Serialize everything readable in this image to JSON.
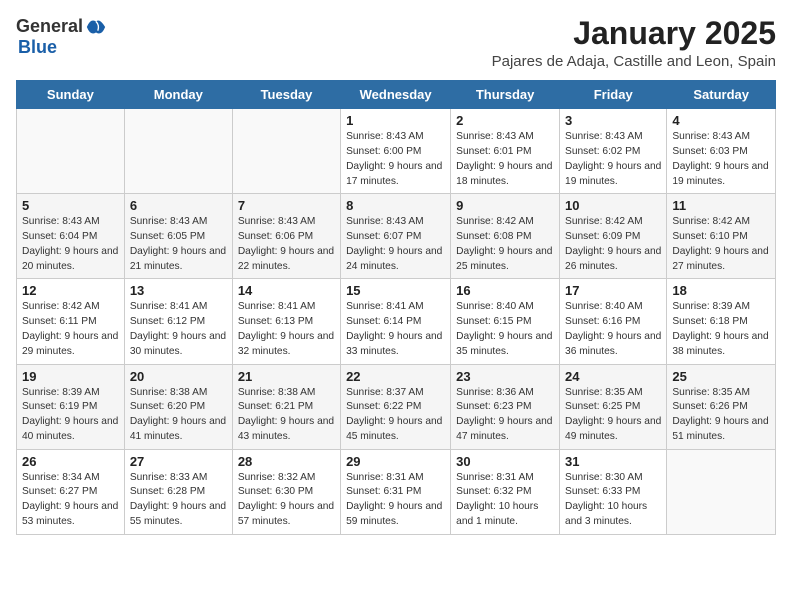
{
  "header": {
    "logo_general": "General",
    "logo_blue": "Blue",
    "month": "January 2025",
    "location": "Pajares de Adaja, Castille and Leon, Spain"
  },
  "weekdays": [
    "Sunday",
    "Monday",
    "Tuesday",
    "Wednesday",
    "Thursday",
    "Friday",
    "Saturday"
  ],
  "weeks": [
    [
      {
        "day": "",
        "detail": ""
      },
      {
        "day": "",
        "detail": ""
      },
      {
        "day": "",
        "detail": ""
      },
      {
        "day": "1",
        "detail": "Sunrise: 8:43 AM\nSunset: 6:00 PM\nDaylight: 9 hours and 17 minutes."
      },
      {
        "day": "2",
        "detail": "Sunrise: 8:43 AM\nSunset: 6:01 PM\nDaylight: 9 hours and 18 minutes."
      },
      {
        "day": "3",
        "detail": "Sunrise: 8:43 AM\nSunset: 6:02 PM\nDaylight: 9 hours and 19 minutes."
      },
      {
        "day": "4",
        "detail": "Sunrise: 8:43 AM\nSunset: 6:03 PM\nDaylight: 9 hours and 19 minutes."
      }
    ],
    [
      {
        "day": "5",
        "detail": "Sunrise: 8:43 AM\nSunset: 6:04 PM\nDaylight: 9 hours and 20 minutes."
      },
      {
        "day": "6",
        "detail": "Sunrise: 8:43 AM\nSunset: 6:05 PM\nDaylight: 9 hours and 21 minutes."
      },
      {
        "day": "7",
        "detail": "Sunrise: 8:43 AM\nSunset: 6:06 PM\nDaylight: 9 hours and 22 minutes."
      },
      {
        "day": "8",
        "detail": "Sunrise: 8:43 AM\nSunset: 6:07 PM\nDaylight: 9 hours and 24 minutes."
      },
      {
        "day": "9",
        "detail": "Sunrise: 8:42 AM\nSunset: 6:08 PM\nDaylight: 9 hours and 25 minutes."
      },
      {
        "day": "10",
        "detail": "Sunrise: 8:42 AM\nSunset: 6:09 PM\nDaylight: 9 hours and 26 minutes."
      },
      {
        "day": "11",
        "detail": "Sunrise: 8:42 AM\nSunset: 6:10 PM\nDaylight: 9 hours and 27 minutes."
      }
    ],
    [
      {
        "day": "12",
        "detail": "Sunrise: 8:42 AM\nSunset: 6:11 PM\nDaylight: 9 hours and 29 minutes."
      },
      {
        "day": "13",
        "detail": "Sunrise: 8:41 AM\nSunset: 6:12 PM\nDaylight: 9 hours and 30 minutes."
      },
      {
        "day": "14",
        "detail": "Sunrise: 8:41 AM\nSunset: 6:13 PM\nDaylight: 9 hours and 32 minutes."
      },
      {
        "day": "15",
        "detail": "Sunrise: 8:41 AM\nSunset: 6:14 PM\nDaylight: 9 hours and 33 minutes."
      },
      {
        "day": "16",
        "detail": "Sunrise: 8:40 AM\nSunset: 6:15 PM\nDaylight: 9 hours and 35 minutes."
      },
      {
        "day": "17",
        "detail": "Sunrise: 8:40 AM\nSunset: 6:16 PM\nDaylight: 9 hours and 36 minutes."
      },
      {
        "day": "18",
        "detail": "Sunrise: 8:39 AM\nSunset: 6:18 PM\nDaylight: 9 hours and 38 minutes."
      }
    ],
    [
      {
        "day": "19",
        "detail": "Sunrise: 8:39 AM\nSunset: 6:19 PM\nDaylight: 9 hours and 40 minutes."
      },
      {
        "day": "20",
        "detail": "Sunrise: 8:38 AM\nSunset: 6:20 PM\nDaylight: 9 hours and 41 minutes."
      },
      {
        "day": "21",
        "detail": "Sunrise: 8:38 AM\nSunset: 6:21 PM\nDaylight: 9 hours and 43 minutes."
      },
      {
        "day": "22",
        "detail": "Sunrise: 8:37 AM\nSunset: 6:22 PM\nDaylight: 9 hours and 45 minutes."
      },
      {
        "day": "23",
        "detail": "Sunrise: 8:36 AM\nSunset: 6:23 PM\nDaylight: 9 hours and 47 minutes."
      },
      {
        "day": "24",
        "detail": "Sunrise: 8:35 AM\nSunset: 6:25 PM\nDaylight: 9 hours and 49 minutes."
      },
      {
        "day": "25",
        "detail": "Sunrise: 8:35 AM\nSunset: 6:26 PM\nDaylight: 9 hours and 51 minutes."
      }
    ],
    [
      {
        "day": "26",
        "detail": "Sunrise: 8:34 AM\nSunset: 6:27 PM\nDaylight: 9 hours and 53 minutes."
      },
      {
        "day": "27",
        "detail": "Sunrise: 8:33 AM\nSunset: 6:28 PM\nDaylight: 9 hours and 55 minutes."
      },
      {
        "day": "28",
        "detail": "Sunrise: 8:32 AM\nSunset: 6:30 PM\nDaylight: 9 hours and 57 minutes."
      },
      {
        "day": "29",
        "detail": "Sunrise: 8:31 AM\nSunset: 6:31 PM\nDaylight: 9 hours and 59 minutes."
      },
      {
        "day": "30",
        "detail": "Sunrise: 8:31 AM\nSunset: 6:32 PM\nDaylight: 10 hours and 1 minute."
      },
      {
        "day": "31",
        "detail": "Sunrise: 8:30 AM\nSunset: 6:33 PM\nDaylight: 10 hours and 3 minutes."
      },
      {
        "day": "",
        "detail": ""
      }
    ]
  ]
}
